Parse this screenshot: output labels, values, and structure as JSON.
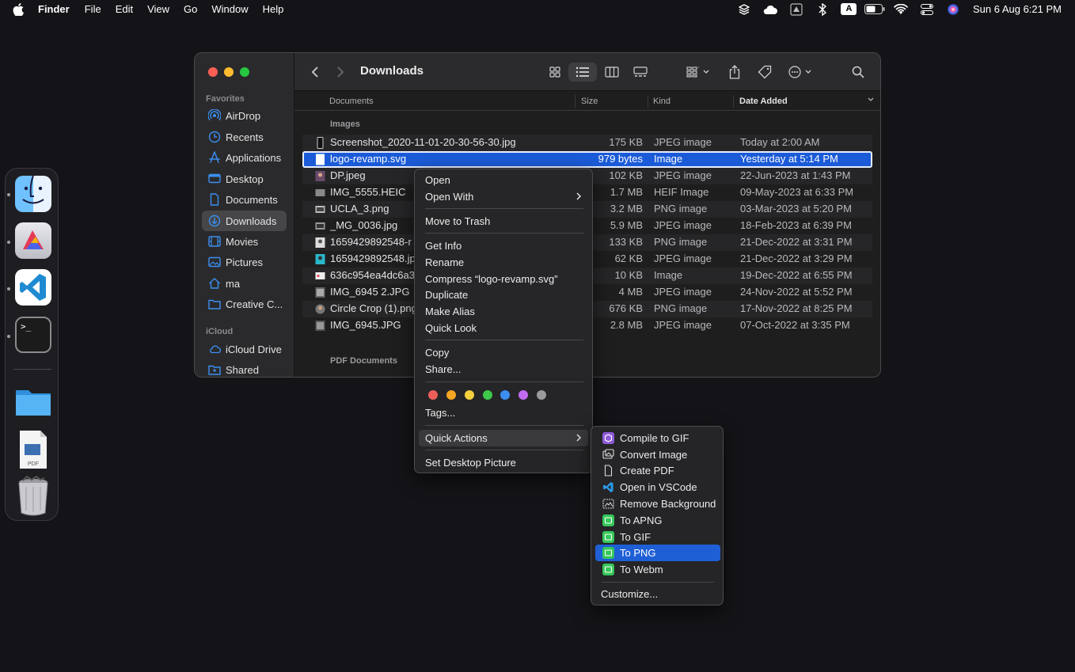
{
  "menubar": {
    "app_name": "Finder",
    "items": [
      "File",
      "Edit",
      "View",
      "Go",
      "Window",
      "Help"
    ],
    "clock": "Sun 6 Aug  6:21 PM",
    "input_source": "A",
    "status_icons": [
      "stacks-icon",
      "cloud-icon",
      "drive-icon",
      "bluetooth-icon",
      "input-source-icon",
      "battery-icon",
      "wifi-icon",
      "control-center-icon",
      "siri-icon"
    ]
  },
  "dock": {
    "apps": [
      "finder-icon",
      "affinity-icon",
      "vscode-icon",
      "terminal-icon",
      "folder-icon",
      "pdf-icon",
      "trash-icon"
    ],
    "pdf_label": "PDF",
    "terminal_prompt": ">_"
  },
  "window": {
    "title": "Downloads",
    "sidebar": {
      "favorites_header": "Favorites",
      "favorites": [
        "AirDrop",
        "Recents",
        "Applications",
        "Desktop",
        "Documents",
        "Downloads",
        "Movies",
        "Pictures",
        "ma",
        "Creative C..."
      ],
      "selected": "Downloads",
      "icloud_header": "iCloud",
      "icloud": [
        "iCloud Drive",
        "Shared"
      ]
    },
    "columns": {
      "name": "Documents",
      "size": "Size",
      "kind": "Kind",
      "date": "Date Added"
    },
    "groups": {
      "images": "Images",
      "pdf": "PDF Documents"
    },
    "files": [
      {
        "name": "Screenshot_2020-11-01-20-30-56-30.jpg",
        "size": "175 KB",
        "kind": "JPEG image",
        "date": "Today at 2:00 AM"
      },
      {
        "name": "logo-revamp.svg",
        "size": "979 bytes",
        "kind": "Image",
        "date": "Yesterday at 5:14 PM"
      },
      {
        "name": "DP.jpeg",
        "size": "102 KB",
        "kind": "JPEG image",
        "date": "22-Jun-2023 at 1:43 PM"
      },
      {
        "name": "IMG_5555.HEIC",
        "size": "1.7 MB",
        "kind": "HEIF Image",
        "date": "09-May-2023 at 6:33 PM"
      },
      {
        "name": "UCLA_3.png",
        "size": "3.2 MB",
        "kind": "PNG image",
        "date": "03-Mar-2023 at 5:20 PM"
      },
      {
        "name": "_MG_0036.jpg",
        "size": "5.9 MB",
        "kind": "JPEG image",
        "date": "18-Feb-2023 at 6:39 PM"
      },
      {
        "name": "1659429892548-r",
        "size": "133 KB",
        "kind": "PNG image",
        "date": "21-Dec-2022 at 3:31 PM"
      },
      {
        "name": "1659429892548.jp",
        "size": "62 KB",
        "kind": "JPEG image",
        "date": "21-Dec-2022 at 3:29 PM"
      },
      {
        "name": "636c954ea4dc6a3",
        "size": "10 KB",
        "kind": "Image",
        "date": "19-Dec-2022 at 6:55 PM"
      },
      {
        "name": "IMG_6945 2.JPG",
        "size": "4 MB",
        "kind": "JPEG image",
        "date": "24-Nov-2022 at 5:52 PM"
      },
      {
        "name": "Circle Crop (1).png",
        "size": "676 KB",
        "kind": "PNG image",
        "date": "17-Nov-2022 at 8:25 PM"
      },
      {
        "name": "IMG_6945.JPG",
        "size": "2.8 MB",
        "kind": "JPEG image",
        "date": "07-Oct-2022 at 3:35 PM"
      }
    ],
    "selected_file": "logo-revamp.svg"
  },
  "context_menu": {
    "open": "Open",
    "open_with": "Open With",
    "move_to_trash": "Move to Trash",
    "get_info": "Get Info",
    "rename": "Rename",
    "compress": "Compress “logo-revamp.svg”",
    "duplicate": "Duplicate",
    "make_alias": "Make Alias",
    "quick_look": "Quick Look",
    "copy": "Copy",
    "share": "Share...",
    "tag_colors": [
      "#ec5f59",
      "#f5a623",
      "#f4d03f",
      "#3ec84a",
      "#3b8ff0",
      "#c26bf2",
      "#9a9a9e"
    ],
    "tags": "Tags...",
    "quick_actions": "Quick Actions",
    "set_desktop_picture": "Set Desktop Picture"
  },
  "quick_actions_menu": {
    "items": [
      {
        "label": "Compile to GIF",
        "icon": "shortcut-cube-icon",
        "color": "#8e5bd8"
      },
      {
        "label": "Convert Image",
        "icon": "image-convert-icon",
        "color": "#3a3a3c"
      },
      {
        "label": "Create PDF",
        "icon": "document-icon",
        "color": "#3a3a3c"
      },
      {
        "label": "Open in VSCode",
        "icon": "vscode-icon",
        "color": "#1e1e1e"
      },
      {
        "label": "Remove Background",
        "icon": "remove-background-icon",
        "color": "#3a3a3c"
      },
      {
        "label": "To APNG",
        "icon": "automator-icon",
        "color": "#34c759"
      },
      {
        "label": "To GIF",
        "icon": "automator-icon",
        "color": "#34c759"
      },
      {
        "label": "To PNG",
        "icon": "automator-icon",
        "color": "#34c759"
      },
      {
        "label": "To Webm",
        "icon": "automator-icon",
        "color": "#34c759"
      }
    ],
    "highlighted": "To PNG",
    "customize": "Customize..."
  },
  "colors": {
    "accent": "#1f5fd6",
    "selection": "#1b5bd8",
    "desktop": "#141418"
  }
}
